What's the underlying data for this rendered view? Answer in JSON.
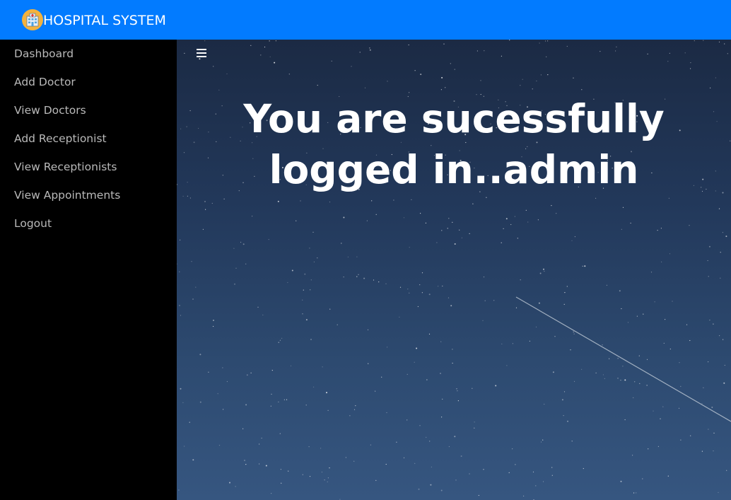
{
  "header": {
    "brand": "HOSPITAL SYSTEM",
    "background_color": "#027bff",
    "logo_icon": "hospital-building-icon"
  },
  "sidebar": {
    "items": [
      {
        "label": "Dashboard"
      },
      {
        "label": "Add Doctor"
      },
      {
        "label": "View Doctors"
      },
      {
        "label": "Add Receptionist"
      },
      {
        "label": "View Receptionists"
      },
      {
        "label": "View Appointments"
      },
      {
        "label": "Logout"
      }
    ]
  },
  "main": {
    "toggle_icon": "hamburger-menu-icon",
    "headline": "You are sucessfully logged in..admin"
  }
}
